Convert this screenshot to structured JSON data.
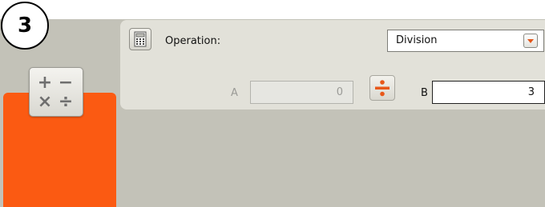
{
  "step": {
    "number": "3"
  },
  "block": {
    "accent_color": "#fb5a12",
    "icon": "math-block-icon",
    "symbols": {
      "plus": "+",
      "minus": "−",
      "times": "×",
      "divide": "÷"
    }
  },
  "config": {
    "icon": "calculator-icon",
    "operation_label": "Operation:",
    "operation_value": "Division",
    "a_label": "A",
    "a_value": "0",
    "operator_icon": "divide-icon",
    "b_label": "B",
    "b_value": "3"
  }
}
